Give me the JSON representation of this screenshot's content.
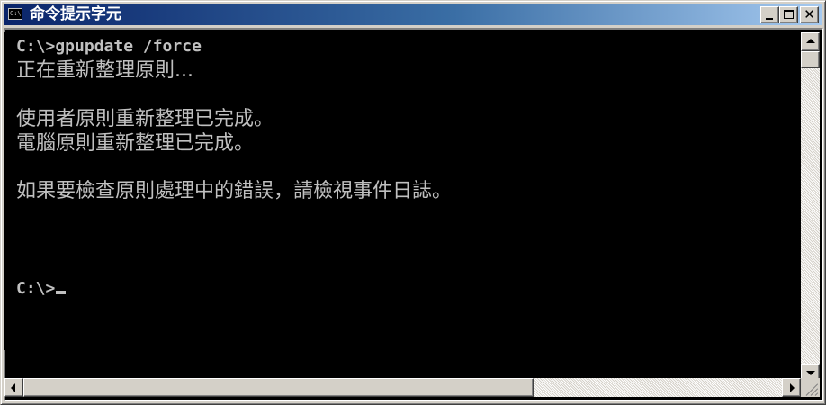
{
  "window": {
    "title": "命令提示字元",
    "icon": "console-icon",
    "icon_text": "C:\\",
    "controls": [
      "minimize-icon",
      "maximize-icon",
      "close-icon"
    ],
    "close_glyph": "✕"
  },
  "console": {
    "lines": [
      "C:\\>gpupdate /force",
      "正在重新整理原則...",
      "",
      "使用者原則重新整理已完成。",
      "電腦原則重新整理已完成。",
      "",
      "如果要檢查原則處理中的錯誤，請檢視事件日誌。",
      "",
      "",
      "C:\\>"
    ],
    "foreground": "#c0c0c0",
    "background": "#000000"
  },
  "colors": {
    "titlebar_start": "#0a246a",
    "titlebar_end": "#a6caf0",
    "chrome": "#d4d0c8"
  }
}
